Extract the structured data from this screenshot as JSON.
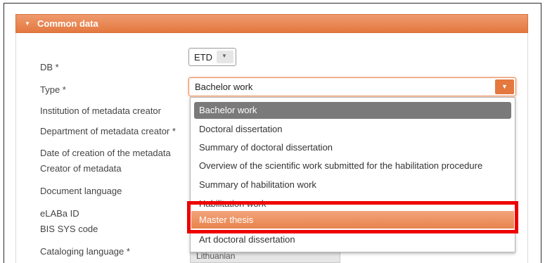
{
  "panel": {
    "title": "Common data"
  },
  "labels": {
    "db": "DB *",
    "type": "Type *",
    "institution": "Institution of metadata creator",
    "department": "Department of metadata creator *",
    "date_created": "Date of creation of the metadata",
    "creator": "Creator of metadata",
    "doc_language": "Document language",
    "elaba_id": "eLABa ID",
    "bis_sys": "BIS SYS code",
    "cataloging_language": "Cataloging language *"
  },
  "db_select": {
    "value": "ETD"
  },
  "type_select": {
    "value": "Bachelor work"
  },
  "dropdown": {
    "options": [
      "Bachelor work",
      "Doctoral dissertation",
      "Summary of doctoral dissertation",
      "Overview of the scientific work submitted for the habilitation procedure",
      "Summary of habilitation work",
      "Habilitation work",
      "Master thesis",
      "Art doctoral dissertation"
    ],
    "selected_index": 0,
    "highlighted_index": 6
  },
  "cataloging_value": "Lithuanian"
}
